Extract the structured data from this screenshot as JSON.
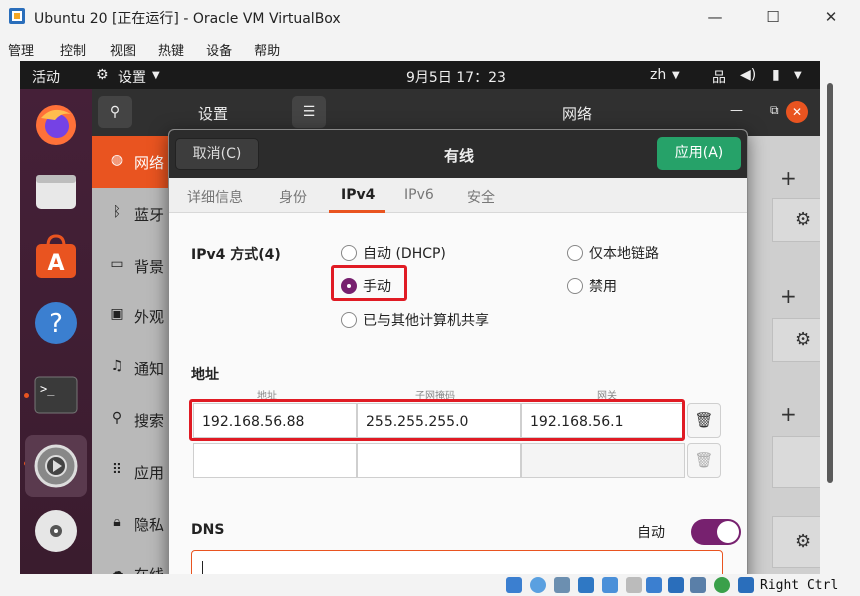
{
  "host": {
    "title": "Ubuntu 20 [正在运行] - Oracle VM VirtualBox",
    "menu": [
      "管理",
      "控制",
      "视图",
      "热键",
      "设备",
      "帮助"
    ],
    "host_key": "Right Ctrl"
  },
  "topbar": {
    "activities": "活动",
    "app_menu": "设置",
    "clock": "9月5日  17：23",
    "input_method": "zh"
  },
  "settings": {
    "sidebar_title": "设置",
    "main_title": "网络",
    "sidebar_items": [
      {
        "icon": "network-icon",
        "label": "网络"
      },
      {
        "icon": "bluetooth-icon",
        "label": "蓝牙"
      },
      {
        "icon": "background-icon",
        "label": "背景"
      },
      {
        "icon": "appearance-icon",
        "label": "外观"
      },
      {
        "icon": "notification-icon",
        "label": "通知"
      },
      {
        "icon": "search-icon",
        "label": "搜索"
      },
      {
        "icon": "apps-icon",
        "label": "应用"
      },
      {
        "icon": "privacy-icon",
        "label": "隐私"
      },
      {
        "icon": "online-accounts-icon",
        "label": "在线"
      }
    ]
  },
  "dialog": {
    "cancel": "取消(C)",
    "title": "有线",
    "apply": "应用(A)",
    "tabs": [
      "详细信息",
      "身份",
      "IPv4",
      "IPv6",
      "安全"
    ],
    "active_tab": "IPv4",
    "method_label": "IPv4 方式(4)",
    "methods": {
      "auto": "自动 (DHCP)",
      "link_local": "仅本地链路",
      "manual": "手动",
      "disabled": "禁用",
      "shared": "已与其他计算机共享"
    },
    "selected_method": "手动",
    "address_section": "地址",
    "columns": [
      "地址",
      "子网掩码",
      "网关"
    ],
    "rows": [
      {
        "address": "192.168.56.88",
        "netmask": "255.255.255.0",
        "gateway": "192.168.56.1"
      },
      {
        "address": "",
        "netmask": "",
        "gateway": ""
      }
    ],
    "dns_label": "DNS",
    "dns_auto_label": "自动",
    "dns_auto_on": true,
    "dns_value": ""
  },
  "colors": {
    "accent": "#e95420",
    "apply_green": "#26a269",
    "toggle_purple": "#77216f",
    "highlight_red": "#e01b24"
  }
}
